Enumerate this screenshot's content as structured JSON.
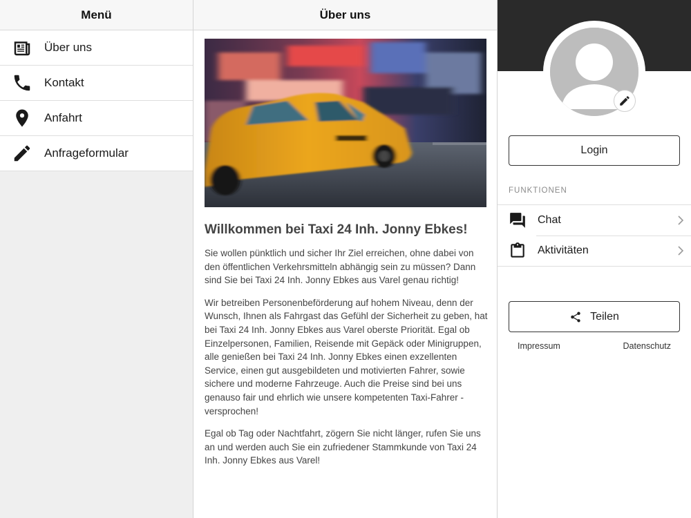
{
  "menu": {
    "title": "Menü",
    "items": [
      {
        "label": "Über uns",
        "icon": "newspaper-icon"
      },
      {
        "label": "Kontakt",
        "icon": "phone-icon"
      },
      {
        "label": "Anfahrt",
        "icon": "map-pin-icon"
      },
      {
        "label": "Anfrageformular",
        "icon": "pencil-icon"
      }
    ]
  },
  "content": {
    "title": "Über uns",
    "heading": "Willkommen bei Taxi 24 Inh. Jonny Ebkes!",
    "paragraphs": [
      "Sie wollen pünktlich und sicher Ihr Ziel erreichen, ohne dabei von den öffentlichen Verkehrsmitteln abhängig sein zu müssen? Dann sind Sie bei Taxi 24 Inh. Jonny Ebkes aus Varel genau richtig!",
      "Wir betreiben Personenbeförderung auf hohem Niveau, denn der Wunsch, Ihnen als Fahrgast das Gefühl der Sicherheit zu geben, hat bei Taxi 24 Inh. Jonny Ebkes aus Varel oberste Priorität. Egal ob Einzelpersonen, Familien, Reisende mit Gepäck oder Minigruppen, alle genießen bei Taxi 24 Inh. Jonny Ebkes einen exzellenten Service, einen gut ausgebildeten und motivierten Fahrer, sowie sichere und moderne Fahrzeuge. Auch die Preise sind bei uns genauso fair und ehrlich wie unsere kompetenten Taxi-Fahrer - versprochen!",
      "Egal ob Tag oder Nachtfahrt, zögern Sie nicht länger, rufen Sie uns an und werden auch Sie ein zufriedener Stammkunde von Taxi 24 Inh. Jonny Ebkes aus Varel!"
    ]
  },
  "profile": {
    "login_label": "Login",
    "section_label": "FUNKTIONEN",
    "functions": [
      {
        "label": "Chat",
        "icon": "chat-bubbles-icon"
      },
      {
        "label": "Aktivitäten",
        "icon": "clipboard-icon"
      }
    ],
    "share_label": "Teilen",
    "footer": {
      "impressum": "Impressum",
      "datenschutz": "Datenschutz"
    }
  },
  "colors": {
    "banner": "#2a2a2a",
    "taxi_yellow": "#e8a31c",
    "avatar_gray": "#bdbdbd"
  }
}
